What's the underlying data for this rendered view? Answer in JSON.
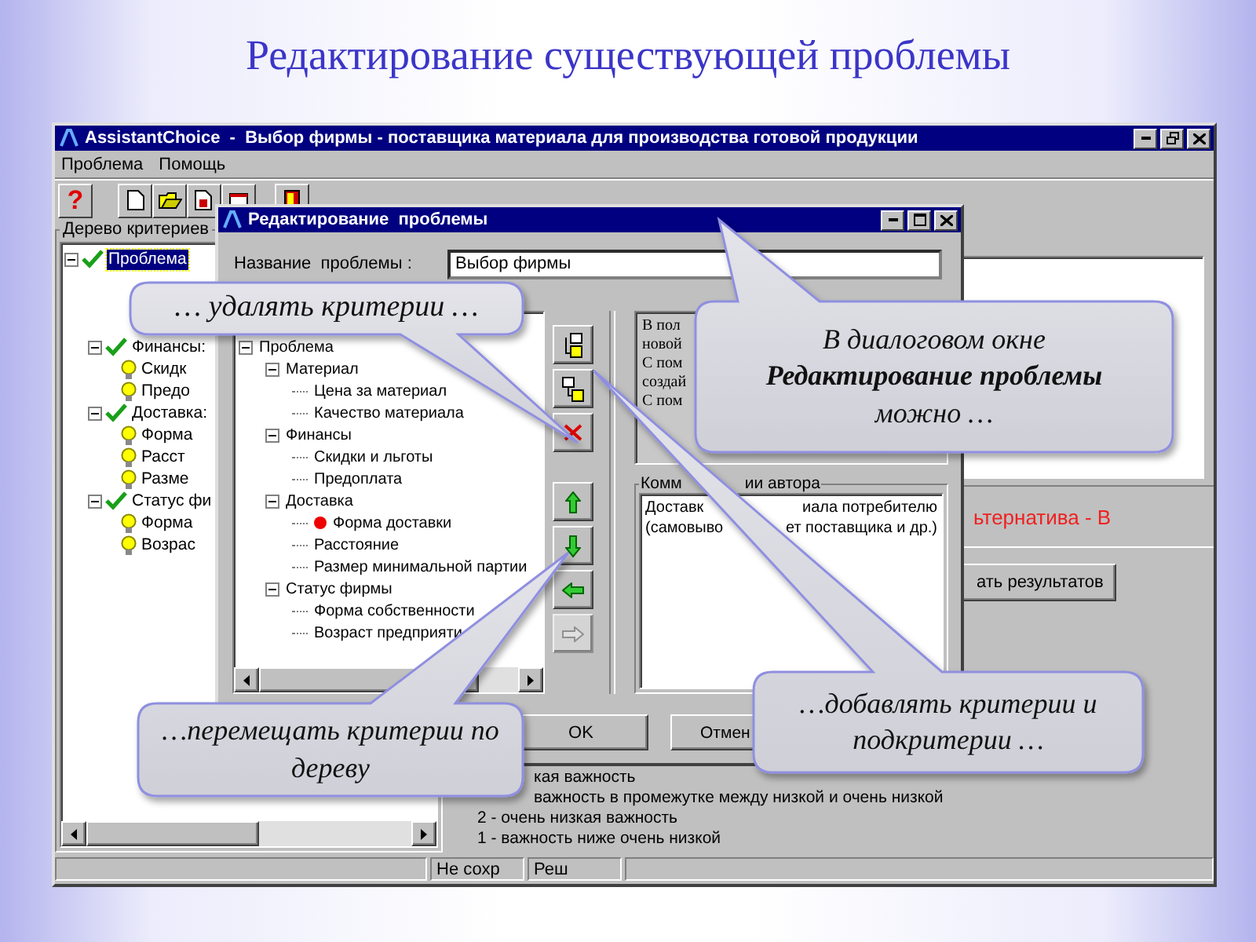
{
  "slide_title": "Редактирование существующей проблемы",
  "main_window": {
    "title": "AssistantChoice  -  Выбор фирмы - поставщика материала для производства готовой продукции",
    "menu": [
      "Проблема",
      "Помощь"
    ],
    "toolbar": [
      {
        "kind": "help",
        "label": "?"
      },
      {
        "kind": "new"
      },
      {
        "kind": "open"
      },
      {
        "kind": "save"
      },
      {
        "kind": "window"
      },
      {
        "kind": "exit"
      }
    ]
  },
  "criteria_tree": {
    "label": "Дерево критериев",
    "items": [
      {
        "label": "Проблема",
        "selected": true,
        "children": [
          {
            "label": "Финансы:",
            "selected": false,
            "children": [
              {
                "label": "Скидк",
                "selected": false
              },
              {
                "label": "Предо",
                "selected": false
              }
            ]
          },
          {
            "label": "Доставка:",
            "selected": false,
            "children": [
              {
                "label": "Форма",
                "selected": false
              },
              {
                "label": "Расст",
                "selected": false
              },
              {
                "label": "Разме",
                "selected": false
              }
            ]
          },
          {
            "label": "Статус фи",
            "selected": false,
            "children": [
              {
                "label": "Форма",
                "selected": false
              },
              {
                "label": "Возрас",
                "selected": false
              }
            ]
          }
        ]
      }
    ]
  },
  "results": {
    "alternative": "ьтернатива - В",
    "button": "ать результатов",
    "importance_scale": [
      "кая важность",
      "важность в промежутке между низкой и очень низкой",
      "2 - очень низкая важность",
      "1 - важность ниже очень низкой"
    ]
  },
  "status_bar": [
    "Не сохр",
    "Реш"
  ],
  "dialog": {
    "title": "Редактирование  проблемы",
    "name_label": "Название  проблемы :",
    "name_value": "Выбор фирмы",
    "tree": [
      {
        "label": "Проблема",
        "marked": false,
        "children": [
          {
            "label": "Материал",
            "marked": false,
            "children": [
              {
                "label": "Цена за материал",
                "marked": false
              },
              {
                "label": "Качество материала",
                "marked": false
              }
            ]
          },
          {
            "label": "Финансы",
            "marked": false,
            "children": [
              {
                "label": "Скидки и льготы",
                "marked": false
              },
              {
                "label": "Предоплата",
                "marked": false
              }
            ]
          },
          {
            "label": "Доставка",
            "marked": false,
            "children": [
              {
                "label": "Форма доставки",
                "marked": true
              },
              {
                "label": "Расстояние",
                "marked": false
              },
              {
                "label": "Размер минимальной партии",
                "marked": false
              }
            ]
          },
          {
            "label": "Статус фирмы",
            "marked": false,
            "children": [
              {
                "label": "Форма собственности",
                "marked": false
              },
              {
                "label": "Возраст предприяти",
                "marked": false
              }
            ]
          }
        ]
      }
    ],
    "tools": [
      {
        "kind": "add-child",
        "disabled": false
      },
      {
        "kind": "add-sibling",
        "disabled": false
      },
      {
        "kind": "delete",
        "disabled": false
      },
      {
        "kind": "up",
        "disabled": false
      },
      {
        "kind": "down",
        "disabled": false
      },
      {
        "kind": "left",
        "disabled": false
      },
      {
        "kind": "right",
        "disabled": true
      }
    ],
    "description": [
      "В пол",
      "новой",
      "С пом",
      "создай",
      "С пом"
    ],
    "comments_label": [
      "Комм",
      "ии автора"
    ],
    "comments": [
      [
        "Доставк",
        "иала потребителю"
      ],
      [
        "(самовыво",
        "ет поставщика и др.)"
      ]
    ],
    "ok": "OK",
    "cancel": "Отмен"
  },
  "callouts": [
    {
      "text": "… удалять критерии …"
    },
    {
      "text": "В диалоговом окне **Редактирование проблемы** можно …"
    },
    {
      "text": "…перемещать критерии по дереву"
    },
    {
      "text": "…добавлять критерии и подкритерии …"
    }
  ]
}
